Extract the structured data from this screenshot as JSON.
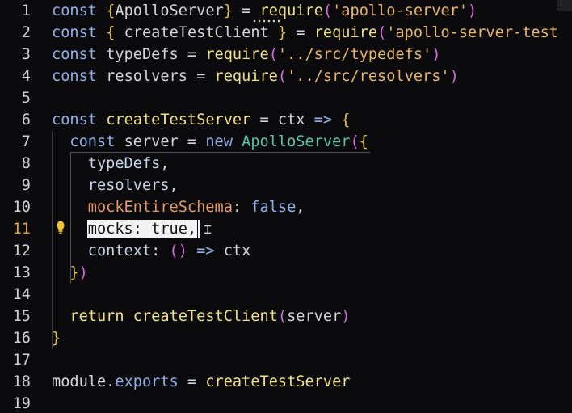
{
  "editor": {
    "active_line": 11,
    "lines": [
      {
        "n": "1",
        "tokens": [
          [
            "kw",
            "const"
          ],
          [
            "p",
            " "
          ],
          [
            "b",
            "{"
          ],
          [
            "i",
            "ApolloServer"
          ],
          [
            "b",
            "}"
          ],
          [
            "p",
            " = "
          ],
          [
            "fn",
            "require"
          ],
          [
            "pa",
            "("
          ],
          [
            "s",
            "'apollo-server'"
          ],
          [
            "pa",
            ")"
          ]
        ]
      },
      {
        "n": "2",
        "tokens": [
          [
            "kw",
            "const"
          ],
          [
            "p",
            " "
          ],
          [
            "b",
            "{"
          ],
          [
            "p",
            " "
          ],
          [
            "i",
            "createTestClient"
          ],
          [
            "p",
            " "
          ],
          [
            "b",
            "}"
          ],
          [
            "p",
            " = "
          ],
          [
            "fn",
            "require"
          ],
          [
            "pa",
            "("
          ],
          [
            "s",
            "'apollo-server-test"
          ]
        ]
      },
      {
        "n": "3",
        "tokens": [
          [
            "kw",
            "const"
          ],
          [
            "p",
            " typeDefs = "
          ],
          [
            "fn",
            "require"
          ],
          [
            "pa",
            "("
          ],
          [
            "s",
            "'../src/typedefs'"
          ],
          [
            "pa",
            ")"
          ]
        ]
      },
      {
        "n": "4",
        "tokens": [
          [
            "kw",
            "const"
          ],
          [
            "p",
            " resolvers = "
          ],
          [
            "fn",
            "require"
          ],
          [
            "pa",
            "("
          ],
          [
            "s",
            "'../src/resolvers'"
          ],
          [
            "pa",
            ")"
          ]
        ]
      },
      {
        "n": "5",
        "tokens": []
      },
      {
        "n": "6",
        "tokens": [
          [
            "kw",
            "const"
          ],
          [
            "p",
            " "
          ],
          [
            "fn",
            "createTestServer"
          ],
          [
            "p",
            " = ctx "
          ],
          [
            "kw",
            "=>"
          ],
          [
            "p",
            " "
          ],
          [
            "b",
            "{"
          ]
        ]
      },
      {
        "n": "7",
        "tokens": [
          [
            "p",
            "  "
          ],
          [
            "kw",
            "const"
          ],
          [
            "p",
            " server = "
          ],
          [
            "kw",
            "new"
          ],
          [
            "p",
            " "
          ],
          [
            "c",
            "ApolloServer"
          ],
          [
            "pa",
            "("
          ],
          [
            "b",
            "{"
          ]
        ]
      },
      {
        "n": "8",
        "tokens": [
          [
            "p",
            "    "
          ],
          [
            "pr",
            "typeDefs"
          ],
          [
            "p",
            ","
          ]
        ]
      },
      {
        "n": "9",
        "tokens": [
          [
            "p",
            "    "
          ],
          [
            "pr",
            "resolvers"
          ],
          [
            "p",
            ","
          ]
        ]
      },
      {
        "n": "10",
        "tokens": [
          [
            "p",
            "    "
          ],
          [
            "po",
            "mockEntireSchema"
          ],
          [
            "p",
            ": "
          ],
          [
            "bo",
            "false"
          ],
          [
            "p",
            ","
          ]
        ]
      },
      {
        "n": "11",
        "tokens": [
          [
            "p",
            "    "
          ],
          [
            "sel",
            "mocks: true,"
          ]
        ]
      },
      {
        "n": "12",
        "tokens": [
          [
            "p",
            "    "
          ],
          [
            "pr",
            "context"
          ],
          [
            "p",
            ": "
          ],
          [
            "pa",
            "()"
          ],
          [
            "p",
            " "
          ],
          [
            "kw",
            "=>"
          ],
          [
            "p",
            " ctx"
          ]
        ]
      },
      {
        "n": "13",
        "tokens": [
          [
            "p",
            "  "
          ],
          [
            "b",
            "}"
          ],
          [
            "pa",
            ")"
          ]
        ]
      },
      {
        "n": "14",
        "tokens": []
      },
      {
        "n": "15",
        "tokens": [
          [
            "p",
            "  "
          ],
          [
            "fn",
            "return"
          ],
          [
            "p",
            " "
          ],
          [
            "fn",
            "createTestClient"
          ],
          [
            "pa",
            "("
          ],
          [
            "p",
            "server"
          ],
          [
            "pa",
            ")"
          ]
        ]
      },
      {
        "n": "16",
        "tokens": [
          [
            "b",
            "}"
          ]
        ]
      },
      {
        "n": "17",
        "tokens": []
      },
      {
        "n": "18",
        "tokens": [
          [
            "p",
            "module."
          ],
          [
            "kw",
            "exports"
          ],
          [
            "p",
            " = "
          ],
          [
            "fn",
            "createTestServer"
          ]
        ]
      },
      {
        "n": "19",
        "tokens": []
      }
    ]
  },
  "colors": {
    "background": "#0b0b0e",
    "line_number": "#d0d0d0",
    "line_number_active": "#e8a33a",
    "keyword": "#8fb0e8",
    "string": "#e8b56b",
    "brace": "#e3c13b",
    "paren": "#d56ee0",
    "class": "#58c6a8",
    "selection": "#f2f2f2"
  },
  "icons": {
    "lightbulb": "lightbulb-icon",
    "cursor": "text-cursor-icon"
  }
}
